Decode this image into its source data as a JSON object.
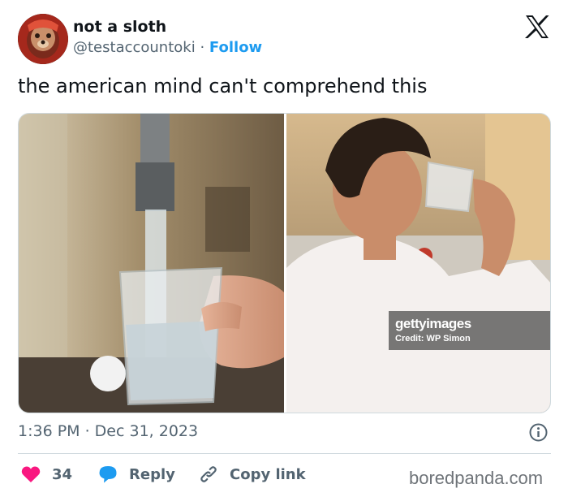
{
  "author": {
    "name": "not a sloth",
    "handle": "@testaccountoki",
    "separator": "·",
    "follow_label": "Follow"
  },
  "tweet": {
    "text": "the american mind can't comprehend this",
    "timestamp": "1:36 PM · Dec 31, 2023"
  },
  "media": {
    "watermark_brand": "gettyimages",
    "watermark_credit": "Credit: WP Simon"
  },
  "actions": {
    "likes": "34",
    "reply_label": "Reply",
    "copy_label": "Copy link"
  },
  "footer": {
    "brand": "boredpanda.com"
  },
  "icons": {
    "platform_logo": "x-logo-icon",
    "info": "info-icon",
    "like": "heart-icon",
    "reply": "speech-bubble-icon",
    "copy": "link-icon"
  },
  "colors": {
    "text": "#0f1419",
    "secondary": "#536471",
    "accent": "#1d9bf0",
    "like": "#f91880",
    "border": "#cfd9de"
  }
}
